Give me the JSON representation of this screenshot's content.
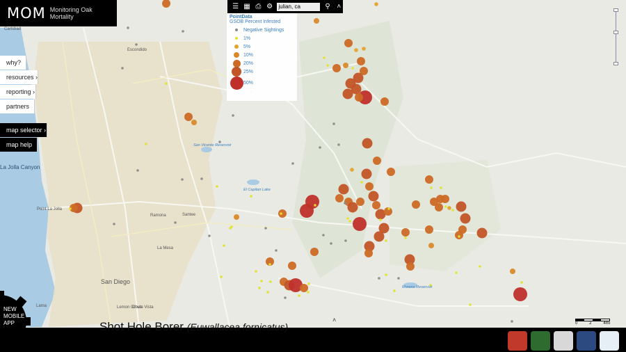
{
  "brand": {
    "abbr": "MOM",
    "full": "Monitoring Oak Mortality"
  },
  "nav": [
    {
      "label": "why?",
      "dark": false
    },
    {
      "label": "resources ›",
      "dark": false
    },
    {
      "label": "reporting ›",
      "dark": false
    },
    {
      "label": "partners",
      "dark": false
    },
    {
      "label": "map selector ›",
      "dark": true
    },
    {
      "label": "map help",
      "dark": true
    }
  ],
  "toolbar": {
    "icons": [
      "list-icon",
      "grid-icon",
      "print-icon",
      "gear-icon",
      "search-icon",
      "chevron-up-icon"
    ],
    "search_value": "julian, ca"
  },
  "legend": {
    "title": "PointData",
    "subtitle": "GSOB Percent Infested",
    "items": [
      {
        "label": "Negative Sightings",
        "color": "#8a8a8a",
        "size": 4
      },
      {
        "label": "1%",
        "color": "#e3e32a",
        "size": 4
      },
      {
        "label": "5%",
        "color": "#e2a32b",
        "size": 6
      },
      {
        "label": "10%",
        "color": "#d98a2a",
        "size": 8
      },
      {
        "label": "20%",
        "color": "#cd6a25",
        "size": 11
      },
      {
        "label": "25%",
        "color": "#c25527",
        "size": 14
      },
      {
        "label": "50%",
        "color": "#c0302b",
        "size": 19
      }
    ]
  },
  "map_labels": {
    "places": [
      {
        "text": "Carlsbad",
        "kind": "city"
      },
      {
        "text": "Escondido",
        "kind": "city"
      },
      {
        "text": "Ramona",
        "kind": "city"
      },
      {
        "text": "Santee",
        "kind": "city"
      },
      {
        "text": "La Mesa",
        "kind": "city"
      },
      {
        "text": "San Diego",
        "kind": "bigcity"
      },
      {
        "text": "Lemon Grove",
        "kind": "city"
      },
      {
        "text": "Chula Vista",
        "kind": "city"
      },
      {
        "text": "Lama",
        "kind": "city"
      },
      {
        "text": "Point La Jolla",
        "kind": "point"
      },
      {
        "text": "La Jolla Canyon",
        "kind": "canyon"
      }
    ],
    "water": [
      {
        "text": "San Vicente Reservoir"
      },
      {
        "text": "El Capitan Lake"
      },
      {
        "text": "Morena Reservoir"
      }
    ]
  },
  "caption": {
    "common": "Shot Hole Borer",
    "scientific": "(Euwallacea fornicatus)"
  },
  "app": {
    "line1": "NEW",
    "line2": "MOBILE",
    "line3": "APP"
  },
  "scale": {
    "labels": [
      "0",
      "2",
      "4mi"
    ]
  },
  "logos": [
    {
      "name": "cal-fire-logo",
      "color": "#c0392b"
    },
    {
      "name": "forest-service-logo",
      "color": "#2e6b2e"
    },
    {
      "name": "uc-seal-logo",
      "color": "#d8d8d8"
    },
    {
      "name": "anr-logo",
      "color": "#2c4a80"
    },
    {
      "name": "ucce-logo",
      "color": "#e6eef6"
    }
  ]
}
